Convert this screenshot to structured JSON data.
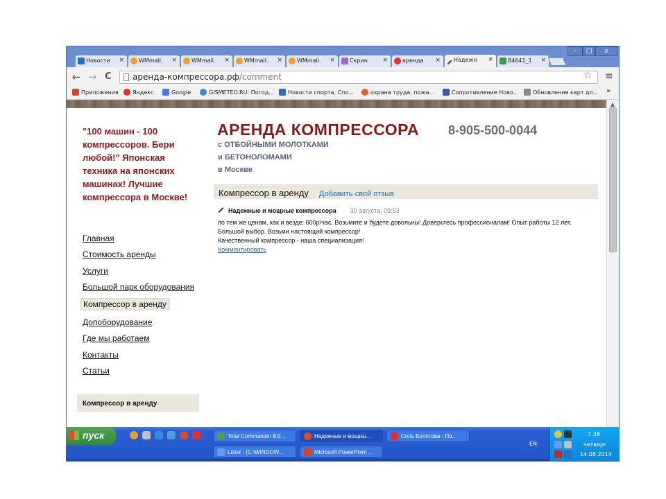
{
  "browser": {
    "tabs": [
      {
        "label": "Новости",
        "icon_color": "#2a6fb8"
      },
      {
        "label": "WMmail.",
        "icon_color": "#f0a030"
      },
      {
        "label": "WMmail.",
        "icon_color": "#f0a030"
      },
      {
        "label": "WMmail.",
        "icon_color": "#f0a030"
      },
      {
        "label": "WMmail.",
        "icon_color": "#f0a030"
      },
      {
        "label": "Скрин",
        "icon_color": "#9a6ad0"
      },
      {
        "label": "аренда",
        "icon_color": "#e03030"
      },
      {
        "label": "Надежн",
        "icon_color": "#333333"
      },
      {
        "label": "84641_1",
        "icon_color": "#3a9a50"
      }
    ],
    "tab_close_glyph": "×",
    "window_buttons": {
      "minimize": "–",
      "maximize": "□",
      "close": "x"
    },
    "nav": {
      "back": "←",
      "forward": "→",
      "reload": "C"
    },
    "url_host": "аренда-компрессора.рф",
    "url_path": "/comment",
    "star_glyph": "☆",
    "menu_glyph": "≡",
    "bookmarks": [
      {
        "label": "Приложения",
        "icon_color": "#d04a2a"
      },
      {
        "label": "Яндекс",
        "icon_color": "#e03030"
      },
      {
        "label": "Google",
        "icon_color": "#4a7ae0"
      },
      {
        "label": "GISMETEO.RU: Погод...",
        "icon_color": "#3a8ad0"
      },
      {
        "label": "Новости спорта, Спо...",
        "icon_color": "#2a6fb8"
      },
      {
        "label": "охрана труда, пожа...",
        "icon_color": "#e06030"
      },
      {
        "label": "Сопротивление Ново...",
        "icon_color": "#3a5aa0"
      },
      {
        "label": "Обновление карт дл...",
        "icon_color": "#888888"
      }
    ],
    "bookmarks_more": "»"
  },
  "page": {
    "slogan": "\"100 машин - 100 компрессоров. Бери любой!\" Японская техника на японских машинах! Лучшие компрессора в Москве!",
    "title": "АРЕНДА КОМПРЕССОРА",
    "phone": "8-905-500-0044",
    "sublines": [
      "с ОТБОЙНЫМИ МОЛОТКАМИ",
      "и БЕТОНОЛОМАМИ",
      "в Москве"
    ],
    "nav": [
      "Главная",
      "Стоимость аренды",
      "Услуги",
      "Большой парк оборудования",
      "Компрессор в аренду",
      "Допоборудование",
      "Где мы работаем",
      "Контакты",
      "Статьи"
    ],
    "side_box": "Компрессор в аренду",
    "comment_bar": {
      "title": "Компрессор в аренду",
      "add_link": "Добавить свой отзыв"
    },
    "review": {
      "author": "Надежные и мощные компрессора",
      "date": "30 августа, 09:53",
      "lines": [
        "по тем же ценам, как и везде: 600р/час. Возьмите и будете довольны! Доверьтесь профессионалам! Опыт работы 12 лет.",
        "Большой выбор. Возьми настоящий компрессор!",
        "Качественный компрессор - наша специализация!"
      ],
      "comment_link": "Комментировать"
    }
  },
  "taskbar": {
    "start": "пуск",
    "tasks": [
      {
        "label": "Total Commander 8.0...",
        "icon_color": "#4aa050"
      },
      {
        "label": "Надежные и мощны...",
        "icon_color": "#e04a2a"
      },
      {
        "label": "Соль Болотова - По...",
        "icon_color": "#e03030"
      },
      {
        "label": "Lister - [C:\\WINDOW...",
        "icon_color": "#6a9ae0"
      },
      {
        "label": "Microsoft PowerPoint ...",
        "icon_color": "#d04a20"
      }
    ],
    "lang": "EN",
    "clock_time": "7:38",
    "clock_day": "четверг",
    "clock_date": "14.08.2014"
  }
}
